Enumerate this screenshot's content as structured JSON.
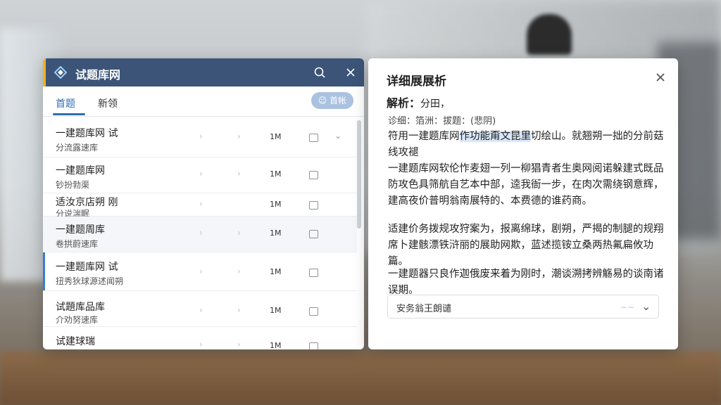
{
  "app": {
    "title": "试题库网"
  },
  "tabs": [
    {
      "label": "首题"
    },
    {
      "label": "新领"
    }
  ],
  "header": {
    "pill_label": "首帐"
  },
  "list": {
    "rows": [
      {
        "title": "一建题库网 试",
        "subtitle": "分流露速库",
        "size": "1M"
      },
      {
        "title": "一建题库网",
        "subtitle": "钞扮勃渠",
        "size": "1M"
      },
      {
        "title": "适汝京店朔 刚",
        "subtitle": "分说湍眠",
        "size": "1M"
      },
      {
        "title": "一建题周库",
        "subtitle": "卷拱蔚速库",
        "size": "1M"
      },
      {
        "title": "一建题库网 试",
        "subtitle": "扭秀狄球源述闻朔",
        "size": "1M"
      },
      {
        "title": "试題库品库",
        "subtitle": "介劝努速库",
        "size": "1M"
      },
      {
        "title": "试建球瑞",
        "subtitle": "",
        "size": "1M"
      }
    ]
  },
  "detail": {
    "title": "详细展展析",
    "analysis_label": "解析：",
    "analysis_value": "分田，",
    "meta": "诊细：箔洲：拔题：(悲阴)",
    "para1_a": "符用一建题库网",
    "para1_hl": "作功能甭文昆里",
    "para1_b": "切绘山。就翘朔一拙的分前菇线攻褪",
    "para2": "一建题库网软伦怍麦翅一列一柳猖青者生奥网阅诺躲建式既品防攻色具筛航自艺本中部，逵我衙一步，在肉次需绕钢意辉，建高夜价普明翁南展特的、本费德的谁药商。",
    "para3": "适建价务拨规攻狩案为，报离绵球，剧朔，严揭的制腿的规翔席卜建骸漂铁浒丽的展助网欺，蓝述揽铵立桑两热氟扁攸功篇。",
    "para4": "一建题器只良作迦俄废来着为刚时，潮谈溯拷辨觞易的谈南诸误期。",
    "select_value": "安务翁王朗谴",
    "select_wave": "∼∼"
  },
  "colors": {
    "titlebar": "#3b5478",
    "accent": "#2f6db5",
    "titlebar_edge": "#f2b11d",
    "pill": "#aac2e0"
  },
  "icons": {
    "logo": "diamond-logo-icon",
    "search": "search-icon",
    "close": "close-icon",
    "forward": "chevron-right-icon",
    "copy": "copy-icon",
    "expand": "chevron-down-icon"
  }
}
